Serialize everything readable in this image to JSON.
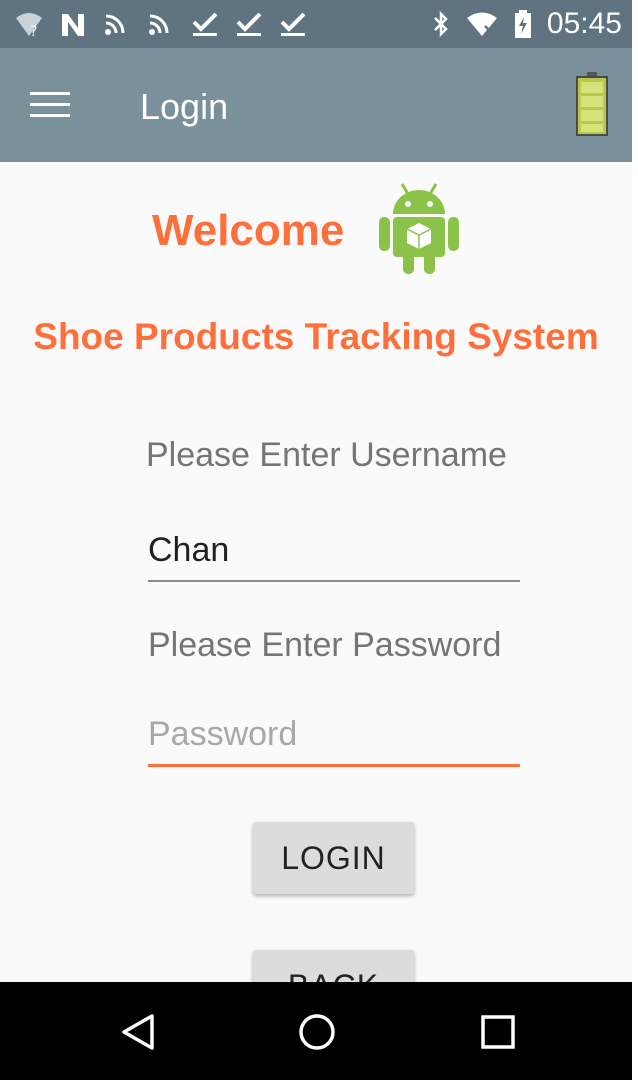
{
  "status_bar": {
    "time": "05:45",
    "icons_left": [
      "wifi-question-icon",
      "n-notification-icon",
      "cast-icon",
      "cast-icon",
      "download-done-icon",
      "download-done-icon",
      "download-done-icon"
    ],
    "icons_right": [
      "bluetooth-icon",
      "wifi-x-icon",
      "battery-charging-icon"
    ]
  },
  "app_bar": {
    "title": "Login",
    "menu_icon": "hamburger-menu-icon",
    "battery_icon": "battery-full-icon"
  },
  "main": {
    "welcome": "Welcome",
    "system_title": "Shoe Products Tracking System",
    "username_label": "Please Enter Username",
    "username_value": "Chan",
    "password_label": "Please Enter Password",
    "password_placeholder": "Password",
    "login_button": "LOGIN",
    "back_button": "BACK"
  },
  "colors": {
    "accent": "#ff6f3c",
    "app_bar": "#7a919c",
    "status_bar": "#5f7480"
  },
  "nav_bar": {
    "icons": [
      "back-triangle-icon",
      "home-circle-icon",
      "recent-square-icon"
    ]
  }
}
